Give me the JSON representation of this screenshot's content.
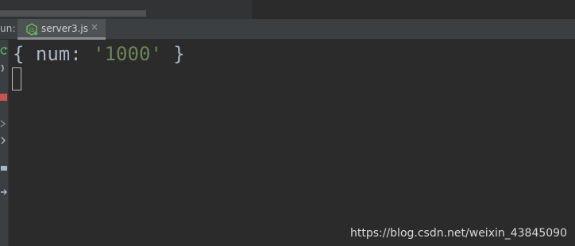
{
  "run_panel": {
    "label": "un:",
    "tab": {
      "label": "server3.js",
      "close_glyph": "×",
      "icon": "nodejs-icon"
    }
  },
  "console": {
    "open_brace": "{ ",
    "key": "num: ",
    "value": "'1000'",
    "close_brace": " }"
  },
  "watermark": "https://blog.csdn.net/weixin_43845090",
  "colors": {
    "background": "#2b2b2b",
    "panel": "#3c3f41",
    "string": "#6a8759",
    "text": "#a9b7c6",
    "node_green": "#6cc24a"
  }
}
